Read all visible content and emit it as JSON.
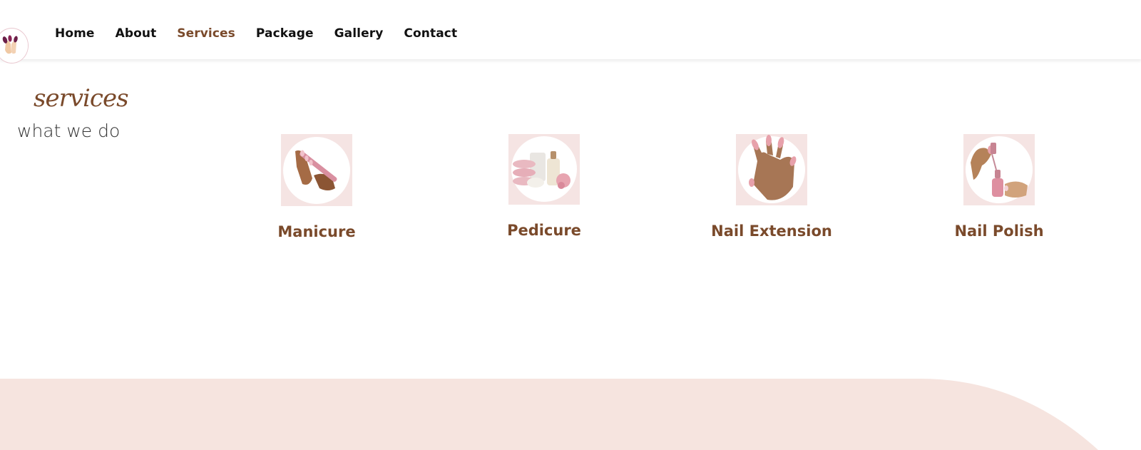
{
  "nav": {
    "logo_icon": "nail-hand-logo-icon",
    "items": [
      {
        "label": "Home",
        "active": false
      },
      {
        "label": "About",
        "active": false
      },
      {
        "label": "Services",
        "active": true
      },
      {
        "label": "Package",
        "active": false
      },
      {
        "label": "Gallery",
        "active": false
      },
      {
        "label": "Contact",
        "active": false
      }
    ]
  },
  "section": {
    "script_title": "services",
    "subtitle": "what we do"
  },
  "services": [
    {
      "label": "Manicure",
      "icon": "manicure-file-icon"
    },
    {
      "label": "Pedicure",
      "icon": "pedicure-products-icon"
    },
    {
      "label": "Nail Extension",
      "icon": "nail-extension-hand-icon"
    },
    {
      "label": "Nail Polish",
      "icon": "nail-polish-bottle-icon"
    }
  ],
  "colors": {
    "accent_brown": "#7a4a2b",
    "icon_bg_pink": "#f5e4e3",
    "wave_pink": "#f6e4df",
    "nav_text": "#111111"
  }
}
